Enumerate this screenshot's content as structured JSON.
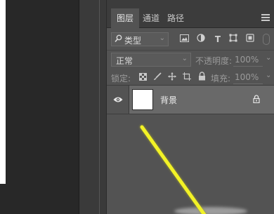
{
  "layers_panel": {
    "tabs": [
      {
        "label": "图层",
        "active": true
      },
      {
        "label": "通道",
        "active": false
      },
      {
        "label": "路径",
        "active": false
      }
    ],
    "filter": {
      "kind_label": "类型",
      "icons": [
        "image-filter-icon",
        "adjustment-filter-icon",
        "type-filter-icon",
        "shape-filter-icon",
        "smart-object-filter-icon"
      ]
    },
    "blend_mode": "正常",
    "opacity_label": "不透明度:",
    "opacity_value": "100%",
    "lock_label": "锁定:",
    "fill_label": "填充:",
    "fill_value": "100%",
    "layers": [
      {
        "name": "背景",
        "visible": true,
        "locked": true
      }
    ]
  },
  "colors": {
    "panel_bg": "#535353",
    "selected_layer_bg": "#696969",
    "canvas_stroke": "#f2f226"
  }
}
